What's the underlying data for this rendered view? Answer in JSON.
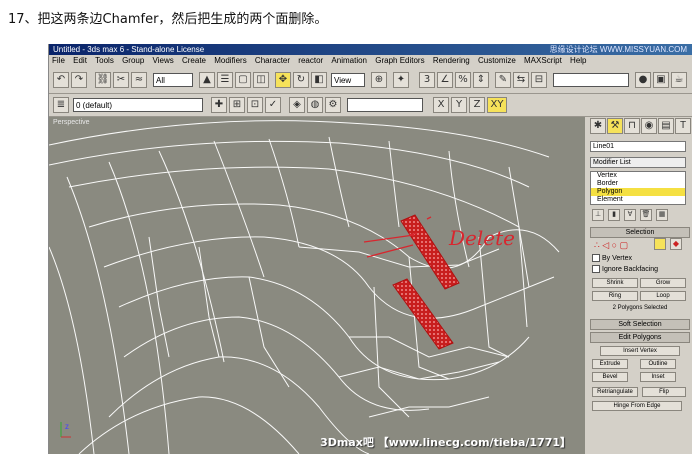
{
  "caption": "17、把这两条边Chamfer，然后把生成的两个面删除。",
  "window": {
    "title": "Untitled - 3ds max 6 - Stand-alone License",
    "watermark": "思缘设计论坛 WWW.MISSYUAN.COM"
  },
  "menu": [
    "File",
    "Edit",
    "Tools",
    "Group",
    "Views",
    "Create",
    "Modifiers",
    "Character",
    "reactor",
    "Animation",
    "Graph Editors",
    "Rendering",
    "Customize",
    "MAXScript",
    "Help"
  ],
  "toolbar1": {
    "selection_filter": "All",
    "ref_coord": "View"
  },
  "toolbar2": {
    "layer": "0 (default)",
    "axis_x": "X",
    "axis_y": "Y",
    "axis_z": "Z",
    "axis_xy": "XY"
  },
  "viewport": {
    "label": "Perspective",
    "annotation": "Delete",
    "overlay": "3Dmax吧 【www.linecg.com/tieba/1771】"
  },
  "panel": {
    "object_name": "Line01",
    "modifier_list": "Modifier List",
    "stack": [
      "Vertex",
      "Border",
      "Polygon",
      "Element"
    ],
    "stack_selected_index": 2,
    "rollouts": {
      "selection": "Selection",
      "by_vertex": "By Vertex",
      "ignore_backfacing": "Ignore Backfacing",
      "shrink": "Shrink",
      "grow": "Grow",
      "ring": "Ring",
      "loop": "Loop",
      "status": "2 Polygons Selected",
      "soft_selection": "Soft Selection",
      "edit_polygons": "Edit Polygons",
      "insert_vertex": "Insert Vertex",
      "extrude": "Extrude",
      "outline": "Outline",
      "bevel": "Bevel",
      "inset": "Inset",
      "retriangulate": "Retriangulate",
      "flip": "Flip",
      "hinge": "Hinge From Edge"
    }
  }
}
